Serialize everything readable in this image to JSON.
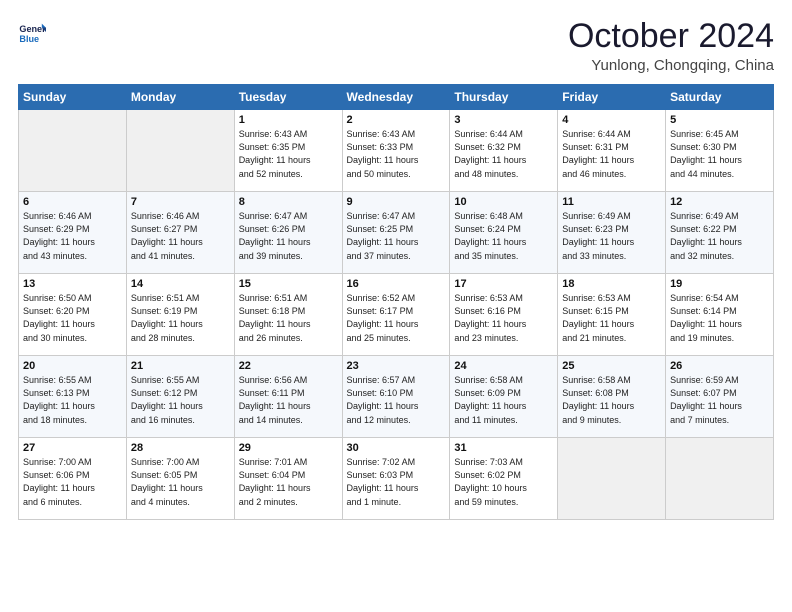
{
  "logo": {
    "line1": "General",
    "line2": "Blue"
  },
  "title": "October 2024",
  "location": "Yunlong, Chongqing, China",
  "weekdays": [
    "Sunday",
    "Monday",
    "Tuesday",
    "Wednesday",
    "Thursday",
    "Friday",
    "Saturday"
  ],
  "weeks": [
    [
      {
        "day": "",
        "info": ""
      },
      {
        "day": "",
        "info": ""
      },
      {
        "day": "1",
        "info": "Sunrise: 6:43 AM\nSunset: 6:35 PM\nDaylight: 11 hours\nand 52 minutes."
      },
      {
        "day": "2",
        "info": "Sunrise: 6:43 AM\nSunset: 6:33 PM\nDaylight: 11 hours\nand 50 minutes."
      },
      {
        "day": "3",
        "info": "Sunrise: 6:44 AM\nSunset: 6:32 PM\nDaylight: 11 hours\nand 48 minutes."
      },
      {
        "day": "4",
        "info": "Sunrise: 6:44 AM\nSunset: 6:31 PM\nDaylight: 11 hours\nand 46 minutes."
      },
      {
        "day": "5",
        "info": "Sunrise: 6:45 AM\nSunset: 6:30 PM\nDaylight: 11 hours\nand 44 minutes."
      }
    ],
    [
      {
        "day": "6",
        "info": "Sunrise: 6:46 AM\nSunset: 6:29 PM\nDaylight: 11 hours\nand 43 minutes."
      },
      {
        "day": "7",
        "info": "Sunrise: 6:46 AM\nSunset: 6:27 PM\nDaylight: 11 hours\nand 41 minutes."
      },
      {
        "day": "8",
        "info": "Sunrise: 6:47 AM\nSunset: 6:26 PM\nDaylight: 11 hours\nand 39 minutes."
      },
      {
        "day": "9",
        "info": "Sunrise: 6:47 AM\nSunset: 6:25 PM\nDaylight: 11 hours\nand 37 minutes."
      },
      {
        "day": "10",
        "info": "Sunrise: 6:48 AM\nSunset: 6:24 PM\nDaylight: 11 hours\nand 35 minutes."
      },
      {
        "day": "11",
        "info": "Sunrise: 6:49 AM\nSunset: 6:23 PM\nDaylight: 11 hours\nand 33 minutes."
      },
      {
        "day": "12",
        "info": "Sunrise: 6:49 AM\nSunset: 6:22 PM\nDaylight: 11 hours\nand 32 minutes."
      }
    ],
    [
      {
        "day": "13",
        "info": "Sunrise: 6:50 AM\nSunset: 6:20 PM\nDaylight: 11 hours\nand 30 minutes."
      },
      {
        "day": "14",
        "info": "Sunrise: 6:51 AM\nSunset: 6:19 PM\nDaylight: 11 hours\nand 28 minutes."
      },
      {
        "day": "15",
        "info": "Sunrise: 6:51 AM\nSunset: 6:18 PM\nDaylight: 11 hours\nand 26 minutes."
      },
      {
        "day": "16",
        "info": "Sunrise: 6:52 AM\nSunset: 6:17 PM\nDaylight: 11 hours\nand 25 minutes."
      },
      {
        "day": "17",
        "info": "Sunrise: 6:53 AM\nSunset: 6:16 PM\nDaylight: 11 hours\nand 23 minutes."
      },
      {
        "day": "18",
        "info": "Sunrise: 6:53 AM\nSunset: 6:15 PM\nDaylight: 11 hours\nand 21 minutes."
      },
      {
        "day": "19",
        "info": "Sunrise: 6:54 AM\nSunset: 6:14 PM\nDaylight: 11 hours\nand 19 minutes."
      }
    ],
    [
      {
        "day": "20",
        "info": "Sunrise: 6:55 AM\nSunset: 6:13 PM\nDaylight: 11 hours\nand 18 minutes."
      },
      {
        "day": "21",
        "info": "Sunrise: 6:55 AM\nSunset: 6:12 PM\nDaylight: 11 hours\nand 16 minutes."
      },
      {
        "day": "22",
        "info": "Sunrise: 6:56 AM\nSunset: 6:11 PM\nDaylight: 11 hours\nand 14 minutes."
      },
      {
        "day": "23",
        "info": "Sunrise: 6:57 AM\nSunset: 6:10 PM\nDaylight: 11 hours\nand 12 minutes."
      },
      {
        "day": "24",
        "info": "Sunrise: 6:58 AM\nSunset: 6:09 PM\nDaylight: 11 hours\nand 11 minutes."
      },
      {
        "day": "25",
        "info": "Sunrise: 6:58 AM\nSunset: 6:08 PM\nDaylight: 11 hours\nand 9 minutes."
      },
      {
        "day": "26",
        "info": "Sunrise: 6:59 AM\nSunset: 6:07 PM\nDaylight: 11 hours\nand 7 minutes."
      }
    ],
    [
      {
        "day": "27",
        "info": "Sunrise: 7:00 AM\nSunset: 6:06 PM\nDaylight: 11 hours\nand 6 minutes."
      },
      {
        "day": "28",
        "info": "Sunrise: 7:00 AM\nSunset: 6:05 PM\nDaylight: 11 hours\nand 4 minutes."
      },
      {
        "day": "29",
        "info": "Sunrise: 7:01 AM\nSunset: 6:04 PM\nDaylight: 11 hours\nand 2 minutes."
      },
      {
        "day": "30",
        "info": "Sunrise: 7:02 AM\nSunset: 6:03 PM\nDaylight: 11 hours\nand 1 minute."
      },
      {
        "day": "31",
        "info": "Sunrise: 7:03 AM\nSunset: 6:02 PM\nDaylight: 10 hours\nand 59 minutes."
      },
      {
        "day": "",
        "info": ""
      },
      {
        "day": "",
        "info": ""
      }
    ]
  ]
}
